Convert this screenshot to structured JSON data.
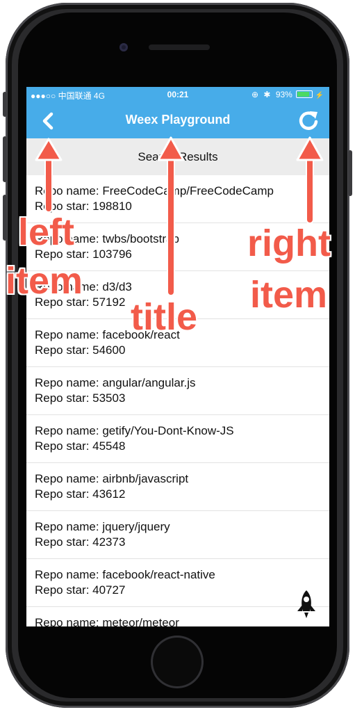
{
  "status_bar": {
    "carrier": "●●●○○ 中国联通  4G",
    "time": "00:21",
    "battery": "93%",
    "battery_level": 0.93
  },
  "navbar": {
    "back_icon": "chevron-left-icon",
    "title": "Weex Playground",
    "refresh_icon": "refresh-icon"
  },
  "subheader": "Search Results",
  "repos": [
    {
      "name": "Repo name: FreeCodeCamp/FreeCodeCamp",
      "stars": "Repo star: 198810"
    },
    {
      "name": "Repo name: twbs/bootstrap",
      "stars": "Repo star: 103796"
    },
    {
      "name": "Repo name: d3/d3",
      "stars": "Repo star: 57192"
    },
    {
      "name": "Repo name: facebook/react",
      "stars": "Repo star: 54600"
    },
    {
      "name": "Repo name: angular/angular.js",
      "stars": "Repo star: 53503"
    },
    {
      "name": "Repo name: getify/You-Dont-Know-JS",
      "stars": "Repo star: 45548"
    },
    {
      "name": "Repo name: airbnb/javascript",
      "stars": "Repo star: 43612"
    },
    {
      "name": "Repo name: jquery/jquery",
      "stars": "Repo star: 42373"
    },
    {
      "name": "Repo name: facebook/react-native",
      "stars": "Repo star: 40727"
    },
    {
      "name": "Repo name: meteor/meteor",
      "stars": ""
    }
  ],
  "annotations": {
    "left_line1": "left",
    "left_line2": "item",
    "title": "title",
    "right_line1": "right",
    "right_line2": "item"
  },
  "colors": {
    "navbar": "#47ace9",
    "annotation": "#f25b4a"
  }
}
